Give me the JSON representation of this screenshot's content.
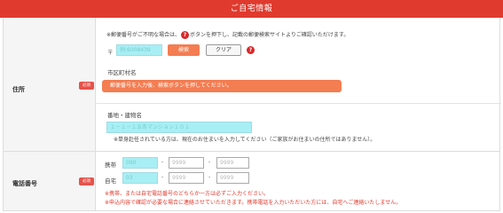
{
  "header": {
    "title": "ご自宅情報"
  },
  "address": {
    "label": "住所",
    "required_badge": "必須",
    "hint_before": "※郵便番号がご不明な場合は、",
    "hint_after": "ボタンを押下し、記載の郵便検索サイトよりご確認いただけます。",
    "help_icon_text": "?",
    "zip_mark": "〒",
    "zip_placeholder": "例:6008439",
    "search_button": "検索",
    "clear_button": "クリア",
    "city_label": "市区町村名",
    "city_banner": "郵便番号を入力後、検索ボタンを押してください。",
    "street_label": "番地・建物名",
    "street_placeholder": "１－１－１五条マンション１０１",
    "street_note": "※単身赴任されている方は、現在のお住まいを入力してください（ご家族がお住まいの住所ではありません）。"
  },
  "phone": {
    "label": "電話番号",
    "required_badge": "必須",
    "mobile_label": "携帯",
    "home_label": "自宅",
    "mobile_part1": "090",
    "home_part1": "03",
    "part_placeholder": "9999",
    "dash": "-",
    "note1": "※携帯、または自宅電話番号のどちらか一方は必ずご入力ください。",
    "note2": "※申込内容で確認が必要な場合に連絡させていただきます。携帯電話を入力いただいた方には、自宅へご連絡いたしません。"
  }
}
